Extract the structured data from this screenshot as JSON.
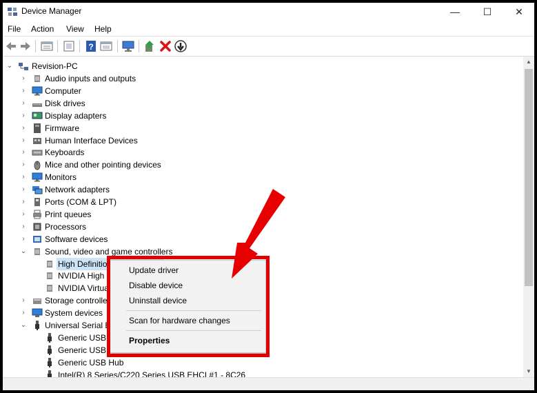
{
  "window": {
    "title": "Device Manager",
    "minimize": "—",
    "maximize": "☐",
    "close": "✕"
  },
  "menu": [
    "File",
    "Action",
    "View",
    "Help"
  ],
  "toolbar": [
    "back-icon",
    "forward-icon",
    "properties-view-icon",
    "show-hidden-icon",
    "help-icon",
    "resource-view-icon",
    "computer-scan-icon",
    "update-driver-icon",
    "uninstall-icon",
    "enable-icon"
  ],
  "tree": {
    "root": "Revision-PC",
    "categories": [
      {
        "label": "Audio inputs and outputs",
        "icon": "speaker-icon",
        "expanded": false
      },
      {
        "label": "Computer",
        "icon": "monitor-icon",
        "expanded": false
      },
      {
        "label": "Disk drives",
        "icon": "disk-icon",
        "expanded": false
      },
      {
        "label": "Display adapters",
        "icon": "display-icon",
        "expanded": false
      },
      {
        "label": "Firmware",
        "icon": "firmware-icon",
        "expanded": false
      },
      {
        "label": "Human Interface Devices",
        "icon": "hid-icon",
        "expanded": false
      },
      {
        "label": "Keyboards",
        "icon": "keyboard-icon",
        "expanded": false
      },
      {
        "label": "Mice and other pointing devices",
        "icon": "mouse-icon",
        "expanded": false
      },
      {
        "label": "Monitors",
        "icon": "monitor-icon",
        "expanded": false
      },
      {
        "label": "Network adapters",
        "icon": "network-icon",
        "expanded": false
      },
      {
        "label": "Ports (COM & LPT)",
        "icon": "port-icon",
        "expanded": false
      },
      {
        "label": "Print queues",
        "icon": "printer-icon",
        "expanded": false
      },
      {
        "label": "Processors",
        "icon": "chip-icon",
        "expanded": false
      },
      {
        "label": "Software devices",
        "icon": "software-icon",
        "expanded": false
      },
      {
        "label": "Sound, video and game controllers",
        "icon": "speaker-icon",
        "expanded": true
      },
      {
        "label": "Storage controllers",
        "icon": "storage-icon",
        "expanded": false
      },
      {
        "label": "System devices",
        "icon": "system-icon",
        "expanded": false
      },
      {
        "label": "Universal Serial Bus controllers",
        "icon": "usb-icon",
        "expanded": true
      }
    ],
    "sound_children": [
      "High Definition Audio Device",
      "NVIDIA High Definition Audio",
      "NVIDIA Virtual Audio Device"
    ],
    "usb_children": [
      "Generic USB Hub",
      "Generic USB Hub",
      "Generic USB Hub",
      "Intel(R) 8 Series/C220 Series USB EHCI #1 - 8C26"
    ]
  },
  "context_menu": {
    "items": [
      "Update driver",
      "Disable device",
      "Uninstall device",
      "Scan for hardware changes",
      "Properties"
    ]
  },
  "colors": {
    "highlight": "#e00000",
    "selection": "#cce4f7"
  }
}
